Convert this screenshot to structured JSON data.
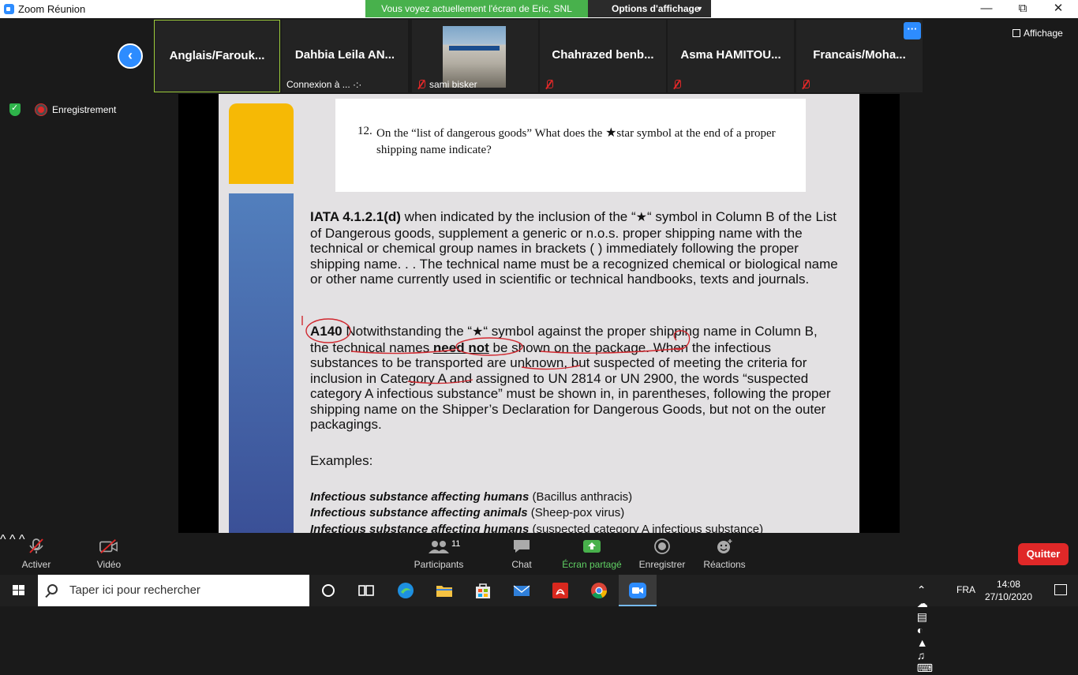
{
  "window": {
    "title": "Zoom Réunion"
  },
  "banner": {
    "text": "Vous voyez actuellement l'écran de Eric, SNL",
    "view_options": "Options d'affichage",
    "affichage": "Affichage"
  },
  "participants": [
    {
      "name": "Anglais/Farouk...",
      "active": true
    },
    {
      "name": "Dahbia  Leila  AN...",
      "sub": "Connexion à ... ·:·"
    },
    {
      "name": "",
      "sub": "sami bisker",
      "photo": true
    },
    {
      "name": "Chahrazed  benb..."
    },
    {
      "name": "Asma  HAMITOU..."
    },
    {
      "name": "Francais/Moha..."
    }
  ],
  "recording": {
    "label": "Enregistrement"
  },
  "slide": {
    "question_number": "12.",
    "question_before_star": "On the “list of dangerous goods” What does the",
    "question_after_star": "star symbol at the end of a proper shipping name indicate?",
    "star": "★",
    "iata_ref": "IATA 4.1.2.1(d)",
    "iata_before_star": " when indicated by the inclusion of the “",
    "iata_after_star": "“ symbol in Column B of the List of Dangerous goods, supplement a generic or n.o.s. proper shipping name with the technical or chemical group names in brackets (   ) immediately following the proper shipping name. . . The technical name must be a recognized chemical or biological name or other name currently used in scientific or technical handbooks, texts and journals.",
    "a140_ref": "A140",
    "a140_before_star": " Notwithstanding the “",
    "a140_mid": "“ symbol against the proper shipping name in Column B, the technical names ",
    "a140_emph": "need not",
    "a140_after": " be shown on the package. When the infectious substances to be transported are unknown, but suspected of meeting the criteria for inclusion in Category A and assigned to UN 2814 or UN 2900, the words “suspected category A infectious substance” must be shown in, in parentheses, following the proper shipping name on the Shipper’s Declaration for Dangerous Goods, but not on the outer packagings.",
    "examples_label": "Examples:",
    "examples": [
      {
        "bold": "Infectious substance affecting humans",
        "rest": " (Bacillus anthracis)"
      },
      {
        "bold": "Infectious substance affecting animals",
        "rest": " (Sheep-pox virus)"
      },
      {
        "bold": "Infectious substance affecting humans",
        "rest": " (suspected category A infectious substance)"
      }
    ]
  },
  "toolbar": {
    "mute": "Activer",
    "video": "Vidéo",
    "participants": "Participants",
    "participants_count": "11",
    "chat": "Chat",
    "share": "Écran partagé",
    "record": "Enregistrer",
    "reactions": "Réactions",
    "quit": "Quitter"
  },
  "taskbar": {
    "search_placeholder": "Taper ici pour rechercher",
    "language": "FRA",
    "time": "14:08",
    "date": "27/10/2020"
  },
  "colors": {
    "share_green": "#48b14c",
    "zoom_blue": "#2d8cff",
    "quit_red": "#e02828",
    "slide_yellow": "#f6b905"
  }
}
